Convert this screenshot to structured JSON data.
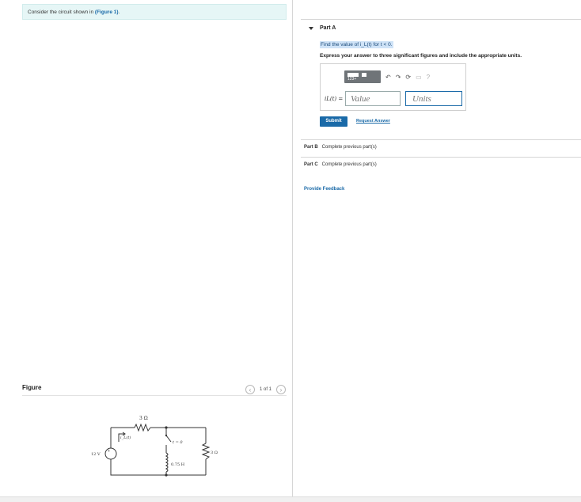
{
  "problem": {
    "prompt_text": "Consider the circuit shown in",
    "figure_link": "(Figure 1)",
    "prompt_suffix": "."
  },
  "figure": {
    "label": "Figure",
    "pager_text": "1 of 1",
    "prev_icon": "chevron-left-icon",
    "next_icon": "chevron-right-icon",
    "circuit": {
      "resistor_top": "3 Ω",
      "current_label": "i_L(t)",
      "source_label": "12 V",
      "switch_label": "t = 0",
      "inductor_label": "0.75 H",
      "resistor_right": "3 Ω"
    }
  },
  "partA": {
    "title": "Part A",
    "question": "Find the value of i_L(t) for t < 0.",
    "instructions": "Express your answer to three significant figures and include the appropriate units.",
    "toolbar": {
      "template_label": "123+",
      "undo_icon": "undo-icon",
      "redo_icon": "redo-icon",
      "reset_icon": "reset-icon",
      "keyboard_icon": "keyboard-icon",
      "help_icon": "help-icon"
    },
    "answer_label": "iL(t) =",
    "value_placeholder": "Value",
    "units_placeholder": "Units",
    "submit_label": "Submit",
    "request_label": "Request Answer"
  },
  "partB": {
    "title": "Part B",
    "status": "Complete previous part(s)"
  },
  "partC": {
    "title": "Part C",
    "status": "Complete previous part(s)"
  },
  "feedback_label": "Provide Feedback",
  "colors": {
    "accent": "#1a6aa8",
    "prompt_bg": "#e6f6f6"
  }
}
